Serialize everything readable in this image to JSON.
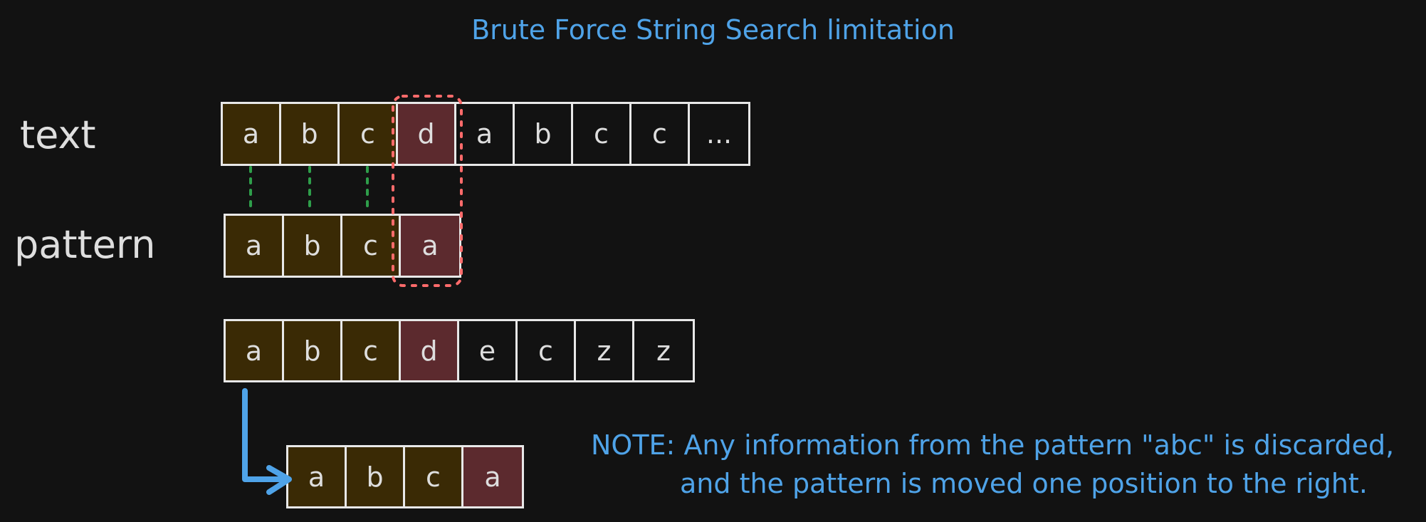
{
  "title": "Brute Force String Search limitation",
  "labels": {
    "text": "text",
    "pattern": "pattern"
  },
  "rows": {
    "text": [
      "a",
      "b",
      "c",
      "d",
      "a",
      "b",
      "c",
      "c",
      "..."
    ],
    "pattern": [
      "a",
      "b",
      "c",
      "a"
    ],
    "example": [
      "a",
      "b",
      "c",
      "d",
      "e",
      "c",
      "z",
      "z"
    ],
    "shifted": [
      "a",
      "b",
      "c",
      "a"
    ]
  },
  "states": {
    "text": [
      "match",
      "match",
      "match",
      "mismatch",
      "plain",
      "plain",
      "plain",
      "plain",
      "plain"
    ],
    "pattern": [
      "match",
      "match",
      "match",
      "mismatch"
    ],
    "example": [
      "match",
      "match",
      "match",
      "mismatch",
      "plain",
      "plain",
      "plain",
      "plain"
    ],
    "shifted": [
      "match",
      "match",
      "match",
      "mismatch"
    ]
  },
  "note": {
    "line1": "NOTE: Any information from the pattern \"abc\" is discarded,",
    "line2": "and the pattern is moved one position to the right."
  },
  "colors": {
    "title": "#4fa3e8",
    "match_fill": "#3a2a05",
    "mismatch_fill": "#5c2a2e",
    "match_connector": "#2e9e4a",
    "mismatch_highlight": "#ff6b6b",
    "arrow": "#4fa3e8"
  }
}
